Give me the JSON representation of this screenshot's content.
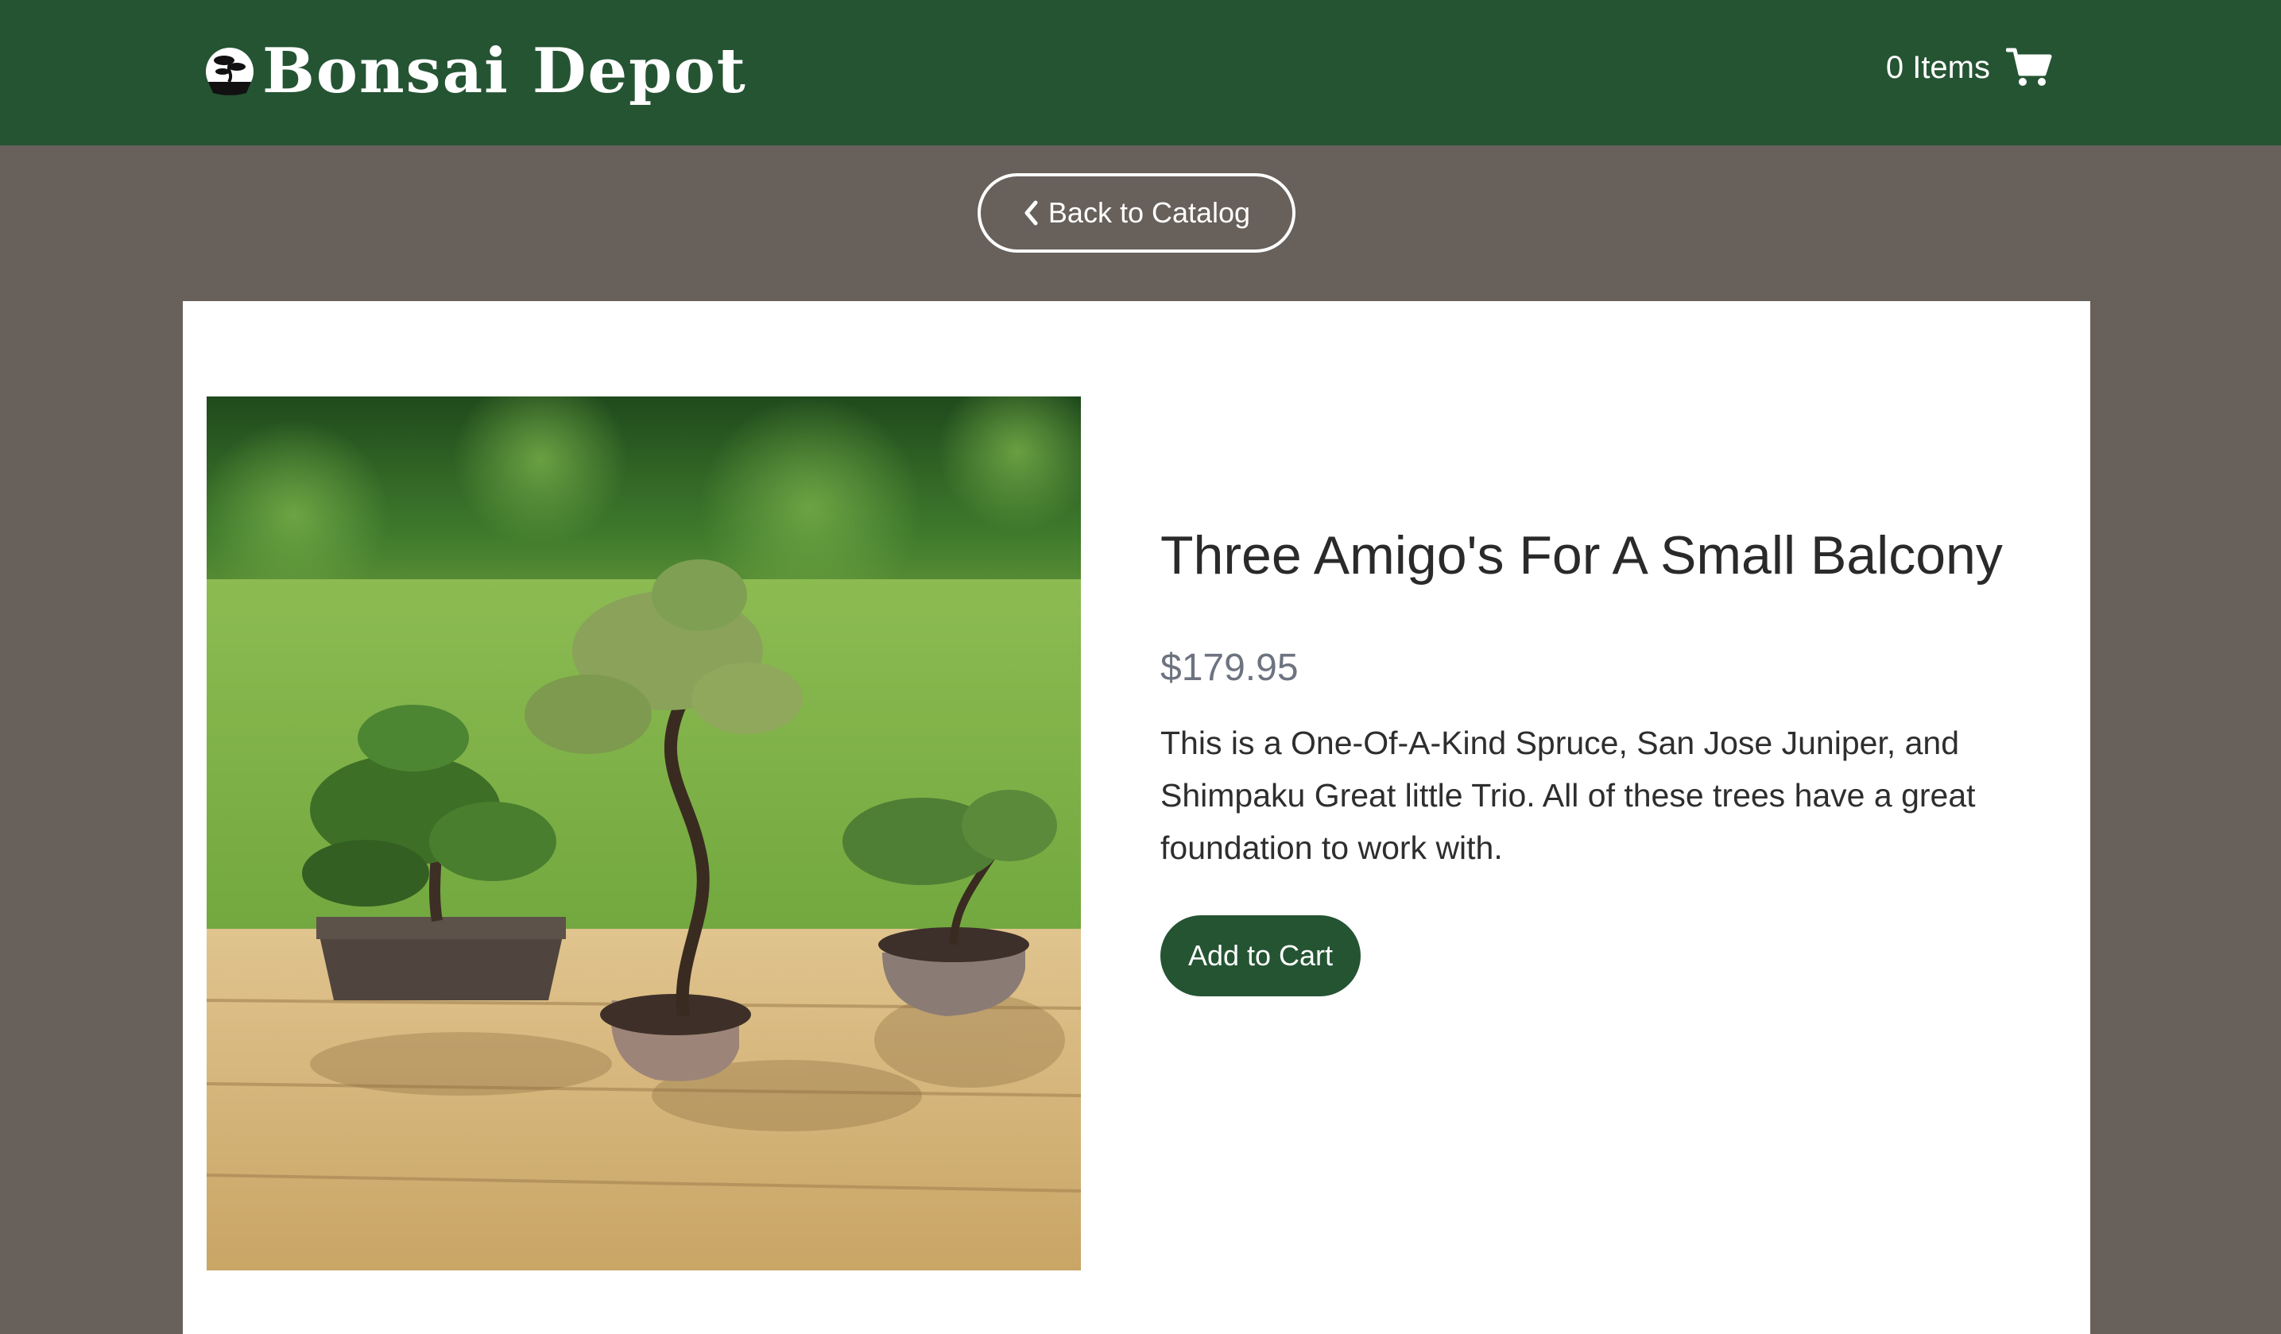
{
  "header": {
    "brand_name": "Bonsai Depot",
    "logo_icon": "bonsai-tree-icon",
    "cart_count_label": "0 Items",
    "cart_icon": "shopping-cart-icon",
    "background_color": "#255433"
  },
  "navigation": {
    "back_label": "Back to Catalog",
    "back_icon": "chevron-left-icon"
  },
  "product": {
    "title": "Three Amigo's For A Small Balcony",
    "price": "$179.95",
    "description": "This is a One-Of-A-Kind Spruce, San Jose Juniper, and Shimpaku Great little Trio. All of these trees have a great foundation to work with.",
    "add_to_cart_label": "Add to Cart",
    "image_alt": "Three bonsai trees on a wooden deck"
  },
  "colors": {
    "brand_green": "#255433",
    "page_background": "#67605b",
    "price_gray": "#6d7380"
  }
}
